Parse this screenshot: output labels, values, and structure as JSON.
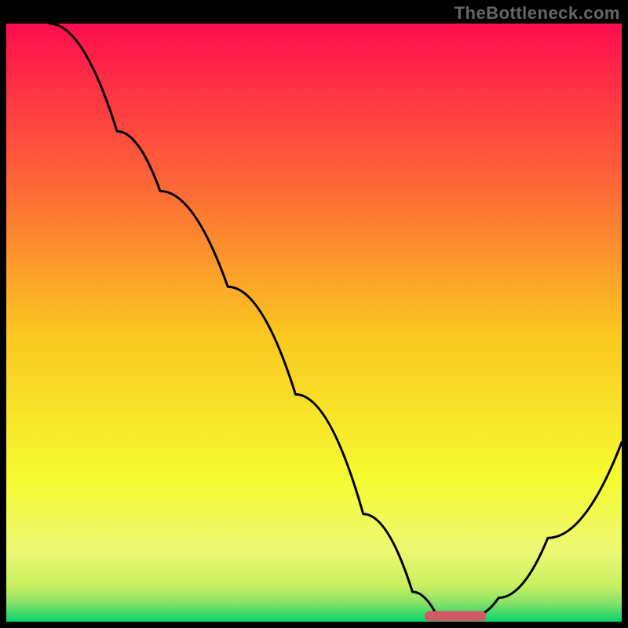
{
  "watermark": "TheBottleneck.com",
  "chart_data": {
    "type": "line",
    "title": "",
    "xlabel": "",
    "ylabel": "",
    "xlim": [
      0,
      100
    ],
    "ylim": [
      0,
      100
    ],
    "grid": false,
    "background_gradient": {
      "stops": [
        {
          "y": 100,
          "color": "#ff0d4d"
        },
        {
          "y": 75,
          "color": "#fd6b36"
        },
        {
          "y": 50,
          "color": "#fbc720"
        },
        {
          "y": 25,
          "color": "#f5fb30"
        },
        {
          "y": 7,
          "color": "#c8f060"
        },
        {
          "y": 0,
          "color": "#05d36c"
        }
      ]
    },
    "series": [
      {
        "name": "bottleneck-curve",
        "color": "#000000",
        "points": [
          {
            "x": 7,
            "y": 100
          },
          {
            "x": 18,
            "y": 82
          },
          {
            "x": 25,
            "y": 72
          },
          {
            "x": 36,
            "y": 56
          },
          {
            "x": 47,
            "y": 38
          },
          {
            "x": 58,
            "y": 18
          },
          {
            "x": 66,
            "y": 5
          },
          {
            "x": 70,
            "y": 1
          },
          {
            "x": 76,
            "y": 1
          },
          {
            "x": 80,
            "y": 4
          },
          {
            "x": 88,
            "y": 14
          },
          {
            "x": 100,
            "y": 30
          }
        ]
      }
    ],
    "marker": {
      "name": "bottleneck-range",
      "color": "#d15b64",
      "x_start": 68,
      "x_end": 78,
      "y": 1
    }
  },
  "colors": {
    "black": "#000000",
    "watermark_gray": "#666666",
    "marker_red": "#d15b64"
  }
}
